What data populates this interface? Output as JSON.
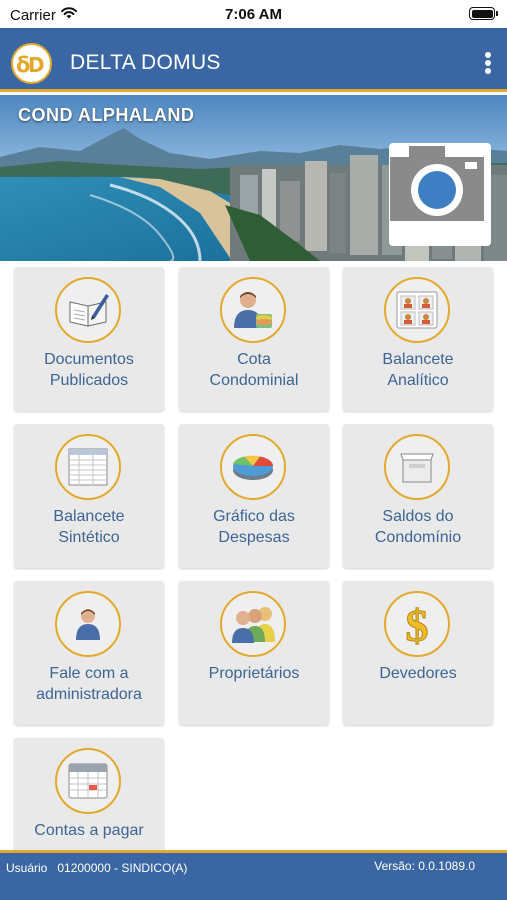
{
  "status_bar": {
    "carrier": "Carrier",
    "time": "7:06 AM"
  },
  "header": {
    "title": "DELTA DOMUS",
    "logo_text": "δD",
    "menu_icon": "more-vertical-icon"
  },
  "hero": {
    "condo_name": "COND ALPHALAND",
    "camera_icon": "camera-icon"
  },
  "menu": [
    {
      "label_1": "Documentos",
      "label_2": "Publicados",
      "icon": "document-pen-icon"
    },
    {
      "label_1": "Cota",
      "label_2": "Condominial",
      "icon": "person-coins-icon"
    },
    {
      "label_1": "Balancete",
      "label_2": "Analítico",
      "icon": "people-cards-icon"
    },
    {
      "label_1": "Balancete",
      "label_2": "Sintético",
      "icon": "spreadsheet-icon"
    },
    {
      "label_1": "Gráfico das",
      "label_2": "Despesas",
      "icon": "pie-chart-icon"
    },
    {
      "label_1": "Saldos do",
      "label_2": "Condomínio",
      "icon": "box-icon"
    },
    {
      "label_1": "Fale com a",
      "label_2": "administradora",
      "icon": "person-icon"
    },
    {
      "label_1": "Proprietários",
      "label_2": "",
      "icon": "group-icon"
    },
    {
      "label_1": "Devedores",
      "label_2": "",
      "icon": "dollar-icon"
    },
    {
      "label_1": "Contas a pagar",
      "label_2": "",
      "icon": "calendar-icon"
    }
  ],
  "footer": {
    "user_label": "Usuário",
    "user_value": "01200000 - SINDICO(A)",
    "version": "Versão: 0.0.1089.0"
  },
  "colors": {
    "primary": "#3a67a3",
    "accent": "#e3a92d",
    "tile": "#e9e9e9",
    "label": "#3c6494"
  }
}
